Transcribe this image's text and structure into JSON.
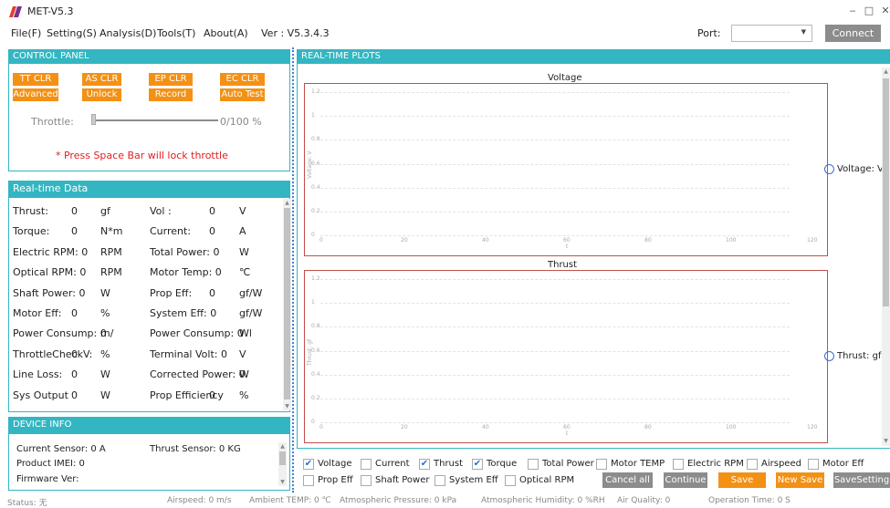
{
  "window": {
    "title": "MET-V5.3"
  },
  "menu": {
    "items": [
      "File(F)",
      "Setting(S)",
      "Analysis(D)",
      "Tools(T)",
      "About(A)"
    ],
    "version": "Ver : V5.3.4.3",
    "port_label": "Port:",
    "port_value": "",
    "connect_label": "Connect"
  },
  "control_panel": {
    "header": "CONTROL PANEL",
    "buttons_row1": [
      "TT CLR",
      "AS CLR",
      "EP CLR",
      "EC CLR"
    ],
    "buttons_row2": [
      "Advanced",
      "Unlock",
      "Record",
      "Auto Test"
    ],
    "throttle_label": "Throttle:",
    "throttle_value": "0/100 %",
    "throttle_level": 0,
    "warning": "* Press Space Bar will lock throttle"
  },
  "realtime": {
    "header": "Real-time Data",
    "rows": [
      {
        "a": "Thrust:",
        "av": "0",
        "au": "gf",
        "b": "Vol :",
        "bv": "0",
        "bu": "V"
      },
      {
        "a": "Torque:",
        "av": "0",
        "au": "N*m",
        "b": "Current:",
        "bv": "0",
        "bu": "A"
      },
      {
        "a": "Electric RPM: 0",
        "av": "",
        "au": "RPM",
        "b": "Total Power: 0",
        "bv": "",
        "bu": "W"
      },
      {
        "a": "Optical RPM: 0",
        "av": "",
        "au": "RPM",
        "b": "Motor Temp: 0",
        "bv": "",
        "bu": "℃"
      },
      {
        "a": "Shaft Power: 0",
        "av": "",
        "au": "W",
        "b": "Prop Eff:",
        "bv": "0",
        "bu": "gf/W"
      },
      {
        "a": "Motor Eff:",
        "av": "0",
        "au": "%",
        "b": "System Eff: 0",
        "bv": "",
        "bu": "gf/W"
      },
      {
        "a": "Power Consump: 0",
        "av": "",
        "au": "m/",
        "b": "Power Consump: 0",
        "bv": "",
        "bu": "Wl"
      },
      {
        "a": "ThrottleCheckV:",
        "av": "0",
        "au": "%",
        "b": "Terminal Volt: 0",
        "bv": "",
        "bu": "V"
      },
      {
        "a": "Line Loss:",
        "av": "0",
        "au": "W",
        "b": "Corrected Power: 0",
        "bv": "",
        "bu": "W"
      },
      {
        "a": "Sys Output",
        "av": "0",
        "au": "W",
        "b": "Prop Efficiency",
        "bv": "0",
        "bu": "%"
      }
    ]
  },
  "device_info": {
    "header": "DEVICE INFO",
    "current_sensor": "Current Sensor: 0 A",
    "thrust_sensor": "Thrust Sensor: 0 KG",
    "product_imei": "Product IMEI:  0",
    "firmware": "Firmware Ver:"
  },
  "plots": {
    "header": "REAL-TIME PLOTS",
    "charts": [
      {
        "title": "Voltage",
        "ylabel": "Voltage: V",
        "xlabel": "t",
        "legend": "Voltage: V"
      },
      {
        "title": "Thrust",
        "ylabel": "Thrust: gf",
        "xlabel": "t",
        "legend": "Thrust: gf"
      }
    ],
    "yticks": [
      "1.2",
      "1",
      "0.8",
      "0.6",
      "0.4",
      "0.2",
      "0"
    ],
    "xticks": [
      "0",
      "20",
      "40",
      "60",
      "80",
      "100",
      "120"
    ]
  },
  "chart_data": [
    {
      "type": "line",
      "title": "Voltage",
      "xlabel": "t",
      "ylabel": "Voltage: V",
      "x": [],
      "series": [
        {
          "name": "Voltage: V",
          "values": []
        }
      ],
      "xlim": [
        0,
        120
      ],
      "ylim": [
        0,
        1.2
      ],
      "grid": true,
      "legend": "right"
    },
    {
      "type": "line",
      "title": "Thrust",
      "xlabel": "t",
      "ylabel": "Thrust: gf",
      "x": [],
      "series": [
        {
          "name": "Thrust: gf",
          "values": []
        }
      ],
      "xlim": [
        0,
        120
      ],
      "ylim": [
        0,
        1.2
      ],
      "grid": true,
      "legend": "right"
    }
  ],
  "checkboxes": {
    "row1": [
      {
        "label": "Voltage",
        "checked": true
      },
      {
        "label": "Current",
        "checked": false
      },
      {
        "label": "Thrust",
        "checked": true
      },
      {
        "label": "Torque",
        "checked": true
      },
      {
        "label": "Total Power",
        "checked": false
      },
      {
        "label": "Motor TEMP",
        "checked": false
      },
      {
        "label": "Electric RPM",
        "checked": false
      },
      {
        "label": "Airspeed",
        "checked": false
      },
      {
        "label": "Motor Eff",
        "checked": false
      }
    ],
    "row2": [
      {
        "label": "Prop Eff",
        "checked": false
      },
      {
        "label": "Shaft Power",
        "checked": false
      },
      {
        "label": "System Eff",
        "checked": false
      },
      {
        "label": "Optical RPM",
        "checked": false
      }
    ],
    "check_glyph": "✔"
  },
  "actions": {
    "cancel_all": "Cancel all",
    "continue": "Continue",
    "save": "Save",
    "new_save": "New Save",
    "save_setting": "SaveSetting"
  },
  "status": {
    "status": "Status: 无",
    "airspeed": "Airspeed: 0 m/s",
    "ambient_temp": "Ambient TEMP: 0 ℃",
    "pressure": "Atmospheric Pressure: 0 kPa",
    "humidity": "Atmospheric Humidity: 0 %RH",
    "air_quality": "Air Quality: 0",
    "operation_time": "Operation Time: 0 S"
  },
  "colors": {
    "accent": "#33b6c2",
    "orange": "#f39115",
    "plot_border": "#c0504d",
    "legend": "#3b6fcf"
  }
}
